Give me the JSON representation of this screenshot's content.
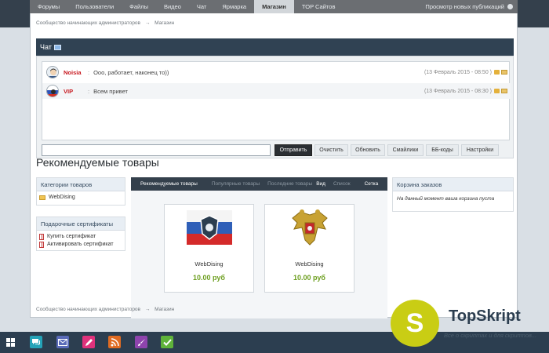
{
  "topnav": {
    "items": [
      "Форумы",
      "Пользователи",
      "Файлы",
      "Видео",
      "Чат",
      "Ярмарка",
      "Магазин",
      "TOP Сайтов"
    ],
    "active_index": 6,
    "right_label": "Просмотр новых публикаций"
  },
  "breadcrumb": {
    "root": "Сообщество начинающих администраторов",
    "separator": "→",
    "current": "Магазин"
  },
  "chat": {
    "title": "Чат",
    "messages": [
      {
        "nick": "Noisia",
        "sep": ":",
        "text": "Ооо, работает, наконец то))",
        "time": "(13 Февраль 2015 - 08:50 )"
      },
      {
        "nick": "VIP",
        "sep": ":",
        "text": "Всем привет",
        "time": "(13 Февраль 2015 - 08:30 )"
      }
    ],
    "input_value": "",
    "buttons": {
      "send": "Отправить",
      "clear": "Очистить",
      "refresh": "Обновить",
      "smilies": "Смайлики",
      "bbcodes": "ББ-коды",
      "settings": "Настройки"
    }
  },
  "recommended_title": "Рекомендуемые товары",
  "categories": {
    "title": "Категории товаров",
    "items": [
      "WebDising"
    ]
  },
  "gifts": {
    "title": "Подарочные сертификаты",
    "items": [
      "Купить сертификат",
      "Активировать сертификат"
    ]
  },
  "tabs": {
    "items": [
      "Рекомендуемые товары",
      "Популярные товары",
      "Последние товары"
    ],
    "active_index": 0,
    "view_label": "Вид",
    "list_label": "Список",
    "grid_label": "Сетка"
  },
  "products": [
    {
      "name": "WebDising",
      "price": "10.00 руб",
      "image": "russian-flag-emblem"
    },
    {
      "name": "WebDising",
      "price": "10.00 руб",
      "image": "russian-coat-of-arms"
    }
  ],
  "cart": {
    "title": "Корзина заказов",
    "empty_text": "На данный момент ваша корзина пуста"
  },
  "taskbar": {
    "icons": [
      "windows-start-icon",
      "chat-icon",
      "mail-icon",
      "pencil-icon",
      "rss-icon",
      "brush-icon",
      "check-icon"
    ]
  },
  "watermark": {
    "logo_letter": "S",
    "brand": "TopSkript",
    "subtitle": "Все о скриптах и для скриптов..."
  }
}
